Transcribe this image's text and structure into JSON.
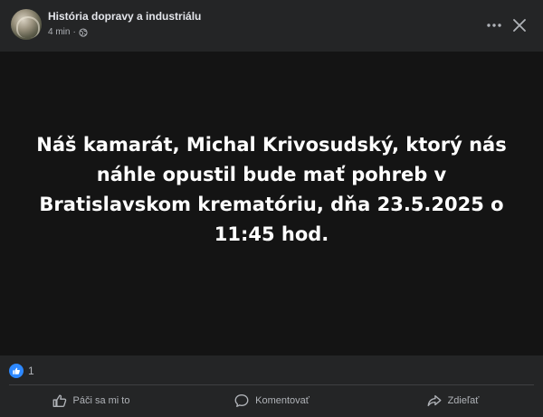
{
  "post": {
    "page_name": "História dopravy a industriálu",
    "time": "4 min",
    "separator": "·",
    "audience_icon": "globe-icon",
    "more_icon": "more-icon",
    "close_icon": "close-icon",
    "media_text": "Náš kamarát, Michal Krivosudský, ktorý nás náhle opustil bude mať pohreb v Bratislavskom krematóriu, dňa 23.5.2025 o 11:45 hod.",
    "reaction_icon": "like-badge-icon",
    "reaction_count": "1"
  },
  "actions": {
    "like": {
      "label": "Páči sa mi to",
      "icon": "thumbs-up-icon"
    },
    "comment": {
      "label": "Komentovať",
      "icon": "comment-icon"
    },
    "share": {
      "label": "Zdieľať",
      "icon": "share-icon"
    }
  },
  "colors": {
    "background": "#242526",
    "media_background": "#141414",
    "primary_text": "#e4e6eb",
    "secondary_text": "#b0b3b8",
    "like_blue": "#2d88ff"
  }
}
